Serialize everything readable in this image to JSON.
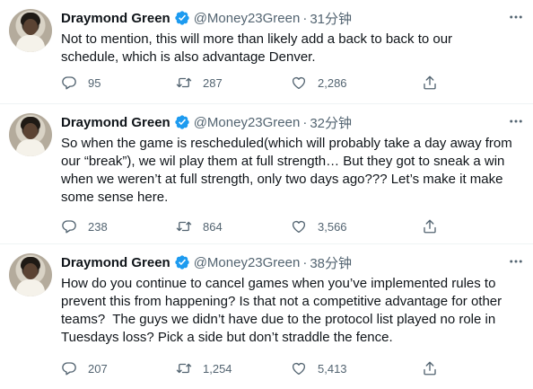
{
  "colors": {
    "text": "#0f1419",
    "secondary": "#536471",
    "verified": "#1d9bf0",
    "divider": "#eff3f4"
  },
  "tweets": [
    {
      "name": "Draymond Green",
      "handle": "@Money23Green",
      "dot": "·",
      "time": "31分钟",
      "text": "Not to mention, this will more than likely add a back to back to our\nschedule, which is also advantage Denver.",
      "replies": "95",
      "retweets": "287",
      "likes": "2,286"
    },
    {
      "name": "Draymond Green",
      "handle": "@Money23Green",
      "dot": "·",
      "time": "32分钟",
      "text": "So when the game is rescheduled(which will probably take a day away from\nour “break”), we wil play them at full strength… But they got to sneak a win\nwhen we weren’t at full strength, only two days ago??? Let’s make it make\nsome sense here.",
      "replies": "238",
      "retweets": "864",
      "likes": "3,566"
    },
    {
      "name": "Draymond Green",
      "handle": "@Money23Green",
      "dot": "·",
      "time": "38分钟",
      "text": "How do you continue to cancel games when you’ve implemented rules to\nprevent this from happening? Is that not a competitive advantage for other\nteams?  The guys we didn’t have due to the protocol list played no role in\nTuesdays loss? Pick a side but don’t straddle the fence.",
      "replies": "207",
      "retweets": "1,254",
      "likes": "5,413"
    }
  ]
}
